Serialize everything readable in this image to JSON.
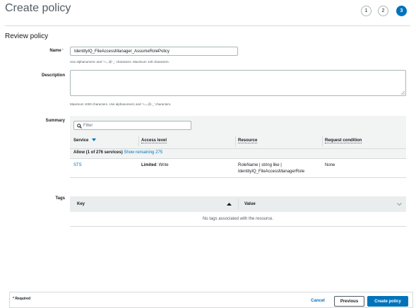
{
  "header": {
    "title": "Create policy",
    "steps": [
      "1",
      "2",
      "3"
    ],
    "active_step": "3"
  },
  "review": {
    "title": "Review policy",
    "name_label": "Name",
    "required_mark": "*",
    "name_value": "IdentityIQ_FileAccessManager_AssumeRolePolicy",
    "name_hint": "Use alphanumeric and '+=,.@-_' characters. Maximum 128 characters.",
    "description_label": "Description",
    "description_value": "",
    "description_hint": "Maximum 1000 characters. Use alphanumeric and '+=,.@-_' characters."
  },
  "summary": {
    "label": "Summary",
    "filter_placeholder": "Filter",
    "columns": {
      "service": "Service",
      "access_level": "Access level",
      "resource": "Resource",
      "request_condition": "Request condition"
    },
    "allow_text": "Allow (1 of 276 services)",
    "show_remaining": "Show remaining 275",
    "rows": [
      {
        "service": "STS",
        "access_bold": "Limited",
        "access_rest": ": Write",
        "resource_line1": "RoleName | string like |",
        "resource_line2": "IdentityIQ_FileAccessManagerRole",
        "request_condition": "None"
      }
    ]
  },
  "tags": {
    "label": "Tags",
    "key_header": "Key",
    "value_header": "Value",
    "empty_text": "No tags associated with the resource."
  },
  "footer": {
    "required_note": "* Required",
    "cancel": "Cancel",
    "previous": "Previous",
    "create": "Create policy"
  },
  "colors": {
    "accent": "#0073bb",
    "panel": "#f2f3f3",
    "border": "#d5dbdb"
  }
}
